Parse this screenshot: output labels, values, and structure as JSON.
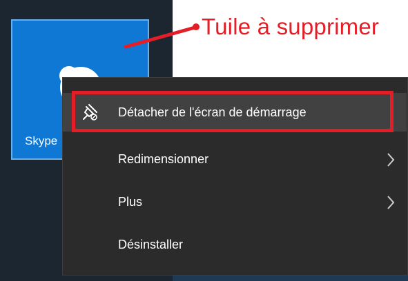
{
  "annotation": {
    "text": "Tuile à supprimer"
  },
  "tile": {
    "label": "Skype",
    "icon": "skype-logo-icon"
  },
  "context_menu": {
    "items": [
      {
        "label": "Détacher de l'écran de démarrage",
        "icon": "unpin-icon",
        "has_submenu": false,
        "highlighted": true
      },
      {
        "label": "Redimensionner",
        "icon": "",
        "has_submenu": true,
        "highlighted": false
      },
      {
        "label": "Plus",
        "icon": "",
        "has_submenu": true,
        "highlighted": false
      },
      {
        "label": "Désinstaller",
        "icon": "",
        "has_submenu": false,
        "highlighted": false
      }
    ]
  },
  "colors": {
    "tile": "#0f78d4",
    "menu_bg": "#2b2b2b",
    "menu_hover": "#414141",
    "annotation": "#e41e26"
  }
}
